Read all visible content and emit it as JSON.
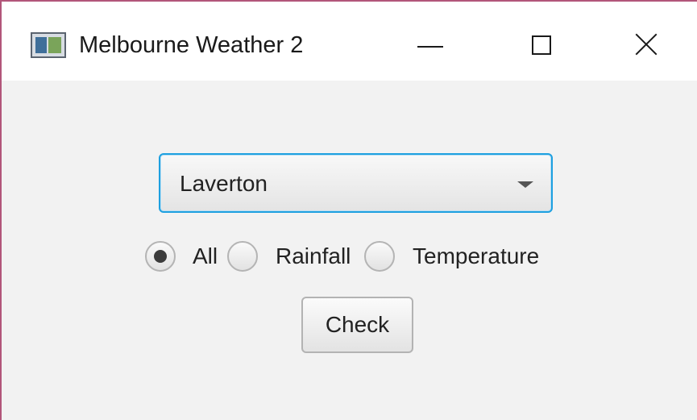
{
  "window": {
    "title": "Melbourne Weather 2",
    "icon": "app-window-icon",
    "controls": {
      "minimize_icon": "minimize-icon",
      "maximize_icon": "maximize-icon",
      "close_icon": "close-icon"
    }
  },
  "station_select": {
    "selected": "Laverton",
    "arrow_icon": "chevron-down-icon",
    "focus_color": "#1ea0e0"
  },
  "filter_radios": [
    {
      "label": "All",
      "selected": true
    },
    {
      "label": "Rainfall",
      "selected": false
    },
    {
      "label": "Temperature",
      "selected": false
    }
  ],
  "check_button": {
    "label": "Check"
  }
}
